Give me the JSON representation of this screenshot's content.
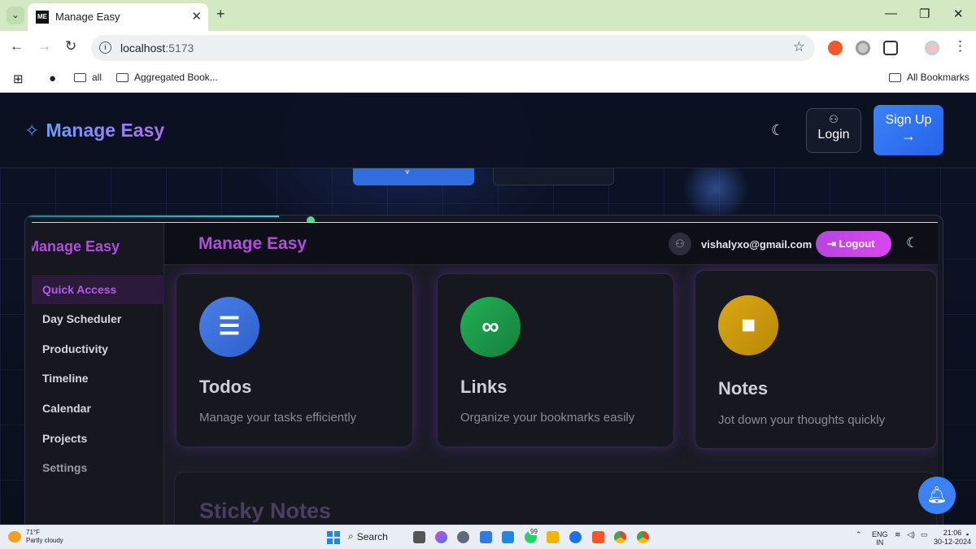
{
  "browser": {
    "tab_title": "Manage Easy",
    "tab_favicon": "ME",
    "url_host": "localhost",
    "url_port": ":5173",
    "bookmarks": [
      "all",
      "Aggregated Book..."
    ],
    "all_bookmarks": "All Bookmarks"
  },
  "site": {
    "brand": "Manage Easy",
    "login_label": "Login",
    "signup_label": "Sign Up"
  },
  "app": {
    "sidebar_brand": "Manage Easy",
    "sidebar_items": [
      "Quick Access",
      "Day Scheduler",
      "Productivity",
      "Timeline",
      "Calendar",
      "Projects",
      "Settings"
    ],
    "title": "Manage Easy",
    "user_email": "vishalyxo@gmail.com",
    "logout_label": "Logout",
    "cards": [
      {
        "title": "Todos",
        "desc": "Manage your tasks efficiently",
        "color": "#3b6fd8"
      },
      {
        "title": "Links",
        "desc": "Organize your bookmarks easily",
        "color": "#16a34a"
      },
      {
        "title": "Notes",
        "desc": "Jot down your thoughts quickly",
        "color": "#ca9a06"
      }
    ],
    "sticky_title": "Sticky Notes"
  },
  "taskbar": {
    "temp": "71°F",
    "weather": "Partly cloudy",
    "search": "Search",
    "badge": "99",
    "lang": "ENG",
    "region": "IN",
    "time": "21:06",
    "date": "30-12-2024"
  }
}
